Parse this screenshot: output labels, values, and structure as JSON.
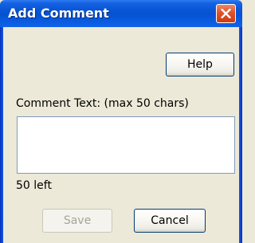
{
  "window": {
    "title": "Add Comment"
  },
  "buttons": {
    "help": "Help",
    "save": "Save",
    "cancel": "Cancel"
  },
  "comment": {
    "label": "Comment Text:  (max 50 chars)",
    "value": "",
    "remaining": "50 left"
  },
  "state": {
    "save_enabled": false
  },
  "colors": {
    "titlebar": "#0553d3",
    "close_button": "#e0522a",
    "dialog_bg": "#ece9d8",
    "button_border": "#003c74",
    "input_border": "#7f9db9"
  },
  "icons": {
    "close": "close-x-icon"
  }
}
